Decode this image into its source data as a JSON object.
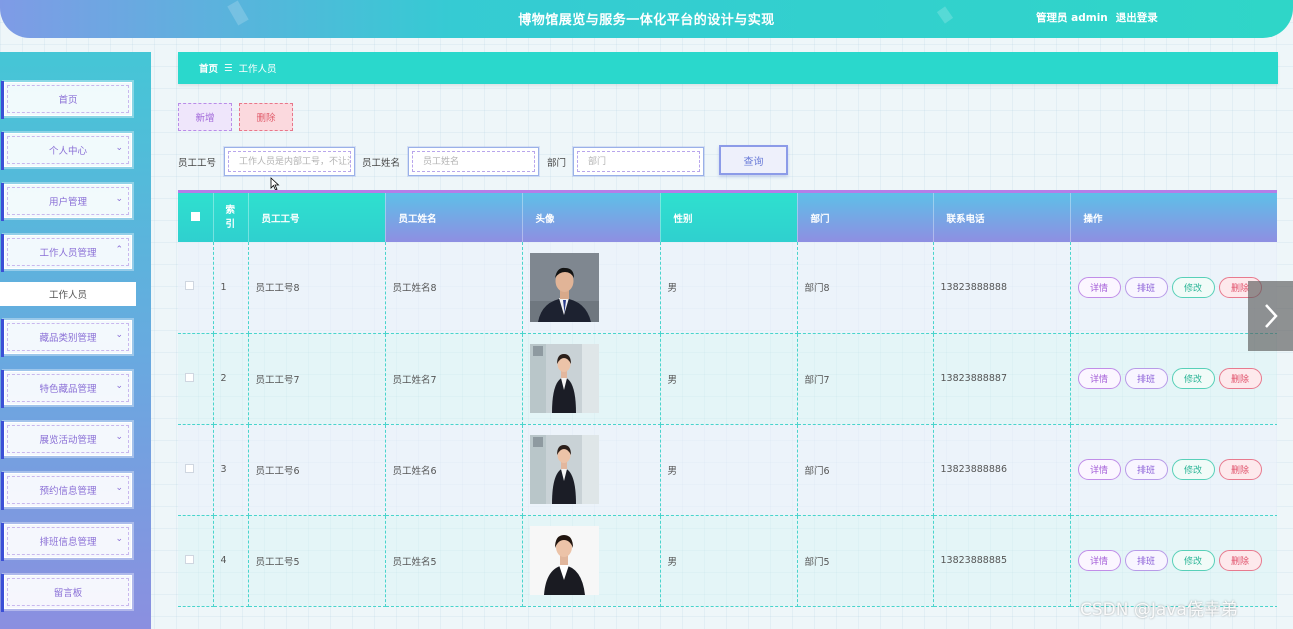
{
  "header": {
    "title": "博物馆展览与服务一体化平台的设计与实现",
    "user_label": "管理员 admin",
    "logout_label": "退出登录"
  },
  "sidebar": {
    "items": [
      {
        "label": "首页",
        "has_chevron": false
      },
      {
        "label": "个人中心",
        "chevron": "⌄"
      },
      {
        "label": "用户管理",
        "chevron": "⌄"
      },
      {
        "label": "工作人员管理",
        "chevron": "⌃"
      },
      {
        "label": "藏品类别管理",
        "chevron": "⌄"
      },
      {
        "label": "特色藏品管理",
        "chevron": "⌄"
      },
      {
        "label": "展览活动管理",
        "chevron": "⌄"
      },
      {
        "label": "预约信息管理",
        "chevron": "⌄"
      },
      {
        "label": "排班信息管理",
        "chevron": "⌄"
      },
      {
        "label": "留言板"
      }
    ],
    "sub_item": "工作人员"
  },
  "breadcrumb": {
    "home": "首页",
    "separator": "☰",
    "current": "工作人员"
  },
  "actions": {
    "add_label": "新增",
    "delete_label": "删除"
  },
  "search": {
    "fields": [
      {
        "label": "员工工号",
        "placeholder": "工作人员是内部工号，不让注册"
      },
      {
        "label": "员工姓名",
        "placeholder": "员工姓名"
      },
      {
        "label": "部门",
        "placeholder": "部门"
      }
    ],
    "button_label": "查询"
  },
  "table": {
    "columns": [
      "索引",
      "员工工号",
      "员工姓名",
      "头像",
      "性别",
      "部门",
      "联系电话",
      "操作"
    ],
    "index_header_line1": "索",
    "index_header_line2": "引",
    "rows": [
      {
        "index": "1",
        "emp_no": "员工工号8",
        "name": "员工姓名8",
        "avatar": "male-suit",
        "gender": "男",
        "dept": "部门8",
        "phone": "13823888888"
      },
      {
        "index": "2",
        "emp_no": "员工工号7",
        "name": "员工姓名7",
        "avatar": "female-suit-office",
        "gender": "男",
        "dept": "部门7",
        "phone": "13823888887"
      },
      {
        "index": "3",
        "emp_no": "员工工号6",
        "name": "员工姓名6",
        "avatar": "female-suit-office",
        "gender": "男",
        "dept": "部门6",
        "phone": "13823888886"
      },
      {
        "index": "4",
        "emp_no": "员工工号5",
        "name": "员工姓名5",
        "avatar": "female-suit-white",
        "gender": "男",
        "dept": "部门5",
        "phone": "13823888885"
      }
    ],
    "ops": {
      "detail": "详情",
      "schedule": "排班",
      "edit": "修改",
      "delete": "删除"
    }
  },
  "watermark": "CSDN @Java侥幸弟",
  "colors": {
    "accent_cyan": "#2ad8cc",
    "accent_purple": "#8e8fe2",
    "delete_red": "#e0506a"
  }
}
